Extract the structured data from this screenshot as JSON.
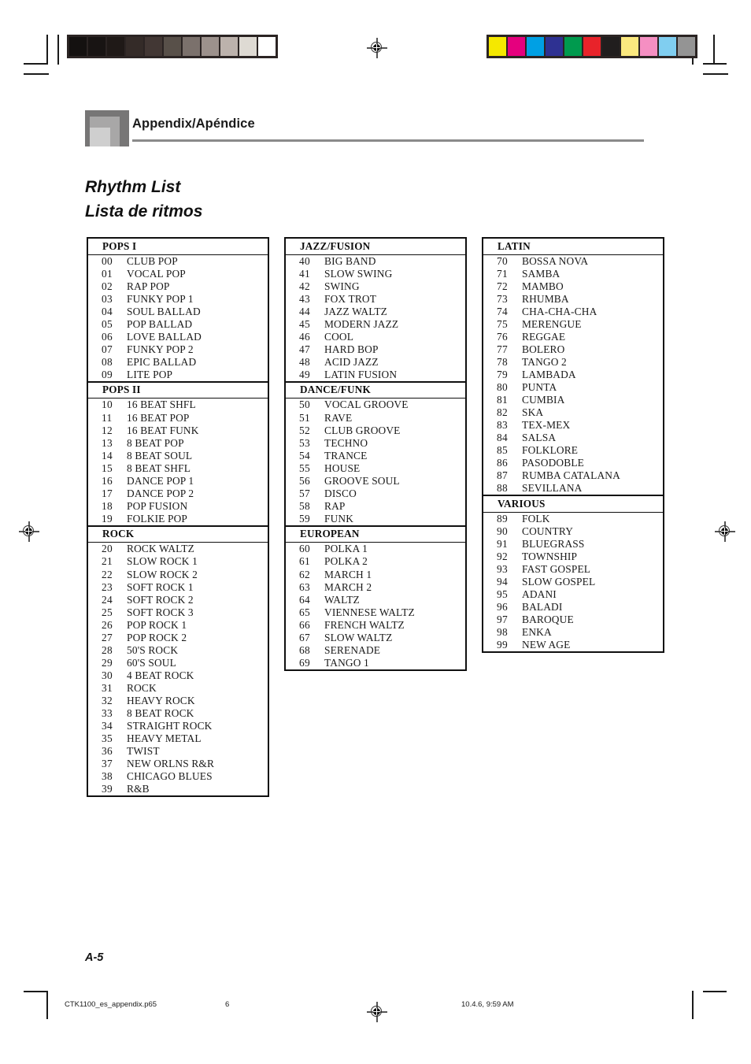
{
  "header": {
    "title": "Appendix/Apéndice",
    "logo_icon": "nested-squares-logo"
  },
  "titles": {
    "english": "Rhythm List",
    "spanish": "Lista de ritmos"
  },
  "footer": {
    "page_number": "A-5",
    "file_name": "CTK1100_es_appendix.p65",
    "sheet_number": "6",
    "timestamp": "10.4.6, 9:59 AM"
  },
  "print_marks": {
    "grayscale_wedge": [
      "#141110",
      "#181413",
      "#1f1917",
      "#342b28",
      "#423734",
      "#585049",
      "#7b716c",
      "#9c918c",
      "#bcb2ac",
      "#dedad3",
      "#ffffff"
    ],
    "color_bar": [
      "#f5e800",
      "#e5007e",
      "#00a0e4",
      "#2e3192",
      "#009a4e",
      "#e8232a",
      "#211e1e",
      "#fbe97f",
      "#f58fc2",
      "#80cef0",
      "#949494"
    ],
    "registration_icon": "registration-target-icon"
  },
  "columns": [
    {
      "sections": [
        {
          "name": "POPS  I",
          "items": [
            {
              "num": "00",
              "name": "CLUB POP"
            },
            {
              "num": "01",
              "name": "VOCAL POP"
            },
            {
              "num": "02",
              "name": "RAP POP"
            },
            {
              "num": "03",
              "name": "FUNKY POP 1"
            },
            {
              "num": "04",
              "name": "SOUL BALLAD"
            },
            {
              "num": "05",
              "name": "POP BALLAD"
            },
            {
              "num": "06",
              "name": "LOVE BALLAD"
            },
            {
              "num": "07",
              "name": "FUNKY POP 2"
            },
            {
              "num": "08",
              "name": "EPIC BALLAD"
            },
            {
              "num": "09",
              "name": "LITE POP"
            }
          ]
        },
        {
          "name": "POPS  II",
          "items": [
            {
              "num": "10",
              "name": "16 BEAT SHFL"
            },
            {
              "num": "11",
              "name": "16 BEAT POP"
            },
            {
              "num": "12",
              "name": "16 BEAT FUNK"
            },
            {
              "num": "13",
              "name": "8 BEAT POP"
            },
            {
              "num": "14",
              "name": "8 BEAT SOUL"
            },
            {
              "num": "15",
              "name": "8 BEAT SHFL"
            },
            {
              "num": "16",
              "name": "DANCE POP 1"
            },
            {
              "num": "17",
              "name": "DANCE POP 2"
            },
            {
              "num": "18",
              "name": "POP FUSION"
            },
            {
              "num": "19",
              "name": "FOLKIE POP"
            }
          ]
        },
        {
          "name": "ROCK",
          "items": [
            {
              "num": "20",
              "name": "ROCK WALTZ"
            },
            {
              "num": "21",
              "name": "SLOW ROCK 1"
            },
            {
              "num": "22",
              "name": "SLOW ROCK 2"
            },
            {
              "num": "23",
              "name": "SOFT ROCK 1"
            },
            {
              "num": "24",
              "name": "SOFT ROCK 2"
            },
            {
              "num": "25",
              "name": "SOFT ROCK 3"
            },
            {
              "num": "26",
              "name": "POP ROCK 1"
            },
            {
              "num": "27",
              "name": "POP ROCK 2"
            },
            {
              "num": "28",
              "name": "50'S ROCK"
            },
            {
              "num": "29",
              "name": "60'S SOUL"
            },
            {
              "num": "30",
              "name": "4 BEAT ROCK"
            },
            {
              "num": "31",
              "name": "ROCK"
            },
            {
              "num": "32",
              "name": "HEAVY ROCK"
            },
            {
              "num": "33",
              "name": "8 BEAT ROCK"
            },
            {
              "num": "34",
              "name": "STRAIGHT ROCK"
            },
            {
              "num": "35",
              "name": "HEAVY METAL"
            },
            {
              "num": "36",
              "name": "TWIST"
            },
            {
              "num": "37",
              "name": "NEW ORLNS R&R"
            },
            {
              "num": "38",
              "name": "CHICAGO BLUES"
            },
            {
              "num": "39",
              "name": "R&B"
            }
          ]
        }
      ]
    },
    {
      "sections": [
        {
          "name": "JAZZ/FUSION",
          "items": [
            {
              "num": "40",
              "name": "BIG BAND"
            },
            {
              "num": "41",
              "name": "SLOW SWING"
            },
            {
              "num": "42",
              "name": "SWING"
            },
            {
              "num": "43",
              "name": "FOX TROT"
            },
            {
              "num": "44",
              "name": "JAZZ WALTZ"
            },
            {
              "num": "45",
              "name": "MODERN JAZZ"
            },
            {
              "num": "46",
              "name": "COOL"
            },
            {
              "num": "47",
              "name": "HARD BOP"
            },
            {
              "num": "48",
              "name": "ACID JAZZ"
            },
            {
              "num": "49",
              "name": "LATIN FUSION"
            }
          ]
        },
        {
          "name": "DANCE/FUNK",
          "items": [
            {
              "num": "50",
              "name": "VOCAL GROOVE"
            },
            {
              "num": "51",
              "name": "RAVE"
            },
            {
              "num": "52",
              "name": "CLUB GROOVE"
            },
            {
              "num": "53",
              "name": "TECHNO"
            },
            {
              "num": "54",
              "name": "TRANCE"
            },
            {
              "num": "55",
              "name": "HOUSE"
            },
            {
              "num": "56",
              "name": "GROOVE SOUL"
            },
            {
              "num": "57",
              "name": "DISCO"
            },
            {
              "num": "58",
              "name": "RAP"
            },
            {
              "num": "59",
              "name": "FUNK"
            }
          ]
        },
        {
          "name": "EUROPEAN",
          "items": [
            {
              "num": "60",
              "name": "POLKA 1"
            },
            {
              "num": "61",
              "name": "POLKA 2"
            },
            {
              "num": "62",
              "name": "MARCH 1"
            },
            {
              "num": "63",
              "name": "MARCH 2"
            },
            {
              "num": "64",
              "name": "WALTZ"
            },
            {
              "num": "65",
              "name": "VIENNESE WALTZ"
            },
            {
              "num": "66",
              "name": "FRENCH WALTZ"
            },
            {
              "num": "67",
              "name": "SLOW WALTZ"
            },
            {
              "num": "68",
              "name": "SERENADE"
            },
            {
              "num": "69",
              "name": "TANGO 1"
            }
          ]
        }
      ]
    },
    {
      "sections": [
        {
          "name": "LATIN",
          "items": [
            {
              "num": "70",
              "name": "BOSSA NOVA"
            },
            {
              "num": "71",
              "name": "SAMBA"
            },
            {
              "num": "72",
              "name": "MAMBO"
            },
            {
              "num": "73",
              "name": "RHUMBA"
            },
            {
              "num": "74",
              "name": "CHA-CHA-CHA"
            },
            {
              "num": "75",
              "name": "MERENGUE"
            },
            {
              "num": "76",
              "name": "REGGAE"
            },
            {
              "num": "77",
              "name": "BOLERO"
            },
            {
              "num": "78",
              "name": "TANGO 2"
            },
            {
              "num": "79",
              "name": "LAMBADA"
            },
            {
              "num": "80",
              "name": "PUNTA"
            },
            {
              "num": "81",
              "name": "CUMBIA"
            },
            {
              "num": "82",
              "name": "SKA"
            },
            {
              "num": "83",
              "name": "TEX-MEX"
            },
            {
              "num": "84",
              "name": "SALSA"
            },
            {
              "num": "85",
              "name": "FOLKLORE"
            },
            {
              "num": "86",
              "name": "PASODOBLE"
            },
            {
              "num": "87",
              "name": "RUMBA CATALANA"
            },
            {
              "num": "88",
              "name": "SEVILLANA"
            }
          ]
        },
        {
          "name": "VARIOUS",
          "items": [
            {
              "num": "89",
              "name": "FOLK"
            },
            {
              "num": "90",
              "name": "COUNTRY"
            },
            {
              "num": "91",
              "name": "BLUEGRASS"
            },
            {
              "num": "92",
              "name": "TOWNSHIP"
            },
            {
              "num": "93",
              "name": "FAST GOSPEL"
            },
            {
              "num": "94",
              "name": "SLOW GOSPEL"
            },
            {
              "num": "95",
              "name": "ADANI"
            },
            {
              "num": "96",
              "name": "BALADI"
            },
            {
              "num": "97",
              "name": "BAROQUE"
            },
            {
              "num": "98",
              "name": "ENKA"
            },
            {
              "num": "99",
              "name": "NEW AGE"
            }
          ]
        }
      ]
    }
  ]
}
